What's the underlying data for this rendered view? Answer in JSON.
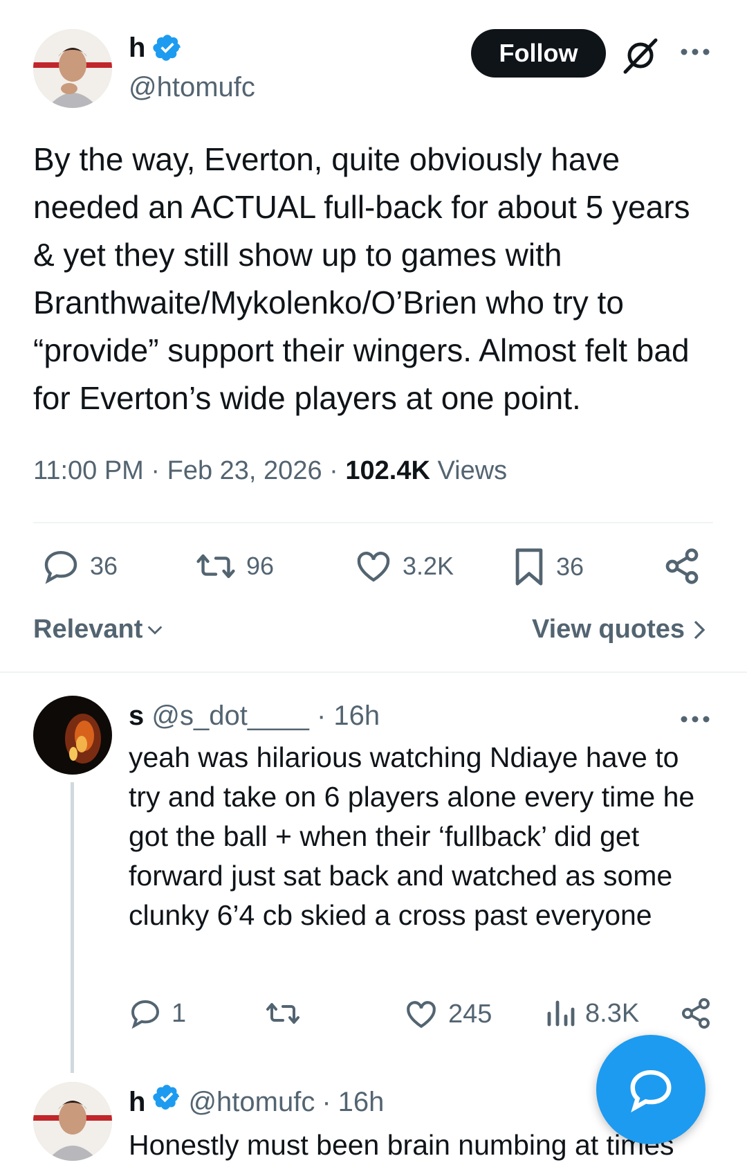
{
  "tweet": {
    "author_name": "h",
    "author_handle": "@htomufc",
    "follow_label": "Follow",
    "text": "By the way, Everton, quite obviously have needed an ACTUAL full-back for about 5 years & yet they still show up to games with Branthwaite/Mykolenko/O’Brien who try to “provide” support their wingers. Almost felt bad for Everton’s wide players at one point.",
    "time": "11:00 PM",
    "date": "Feb 23, 2026",
    "views_count": "102.4K",
    "views_label": "Views",
    "sep": "·",
    "replies": "36",
    "reposts": "96",
    "likes": "3.2K",
    "bookmarks": "36"
  },
  "sort": {
    "label": "Relevant",
    "view_quotes": "View quotes"
  },
  "reply1": {
    "name": "s",
    "handle": "@s_dot____",
    "sep": "·",
    "time": "16h",
    "text": "yeah was hilarious watching Ndiaye have to try and take on 6 players alone every time he got the ball + when their ‘fullback’ did get forward just sat back and watched as some clunky 6’4 cb skied a cross past everyone",
    "replies": "1",
    "likes": "245",
    "views": "8.3K"
  },
  "reply2": {
    "name": "h",
    "handle": "@htomufc",
    "sep": "·",
    "time": "16h",
    "text": "Honestly must been brain numbing at times"
  },
  "icons": {
    "verified": "verified-badge-icon",
    "grok": "grok-icon",
    "more": "more-dots-icon",
    "reply": "reply-icon",
    "repost": "repost-icon",
    "like": "like-icon",
    "bookmark": "bookmark-icon",
    "share": "share-icon",
    "views": "views-icon",
    "compose": "compose-reply-icon"
  },
  "colors": {
    "accent": "#1d9bf0",
    "text": "#0f1419",
    "secondary": "#536471",
    "follow_bg": "#0f1419"
  }
}
